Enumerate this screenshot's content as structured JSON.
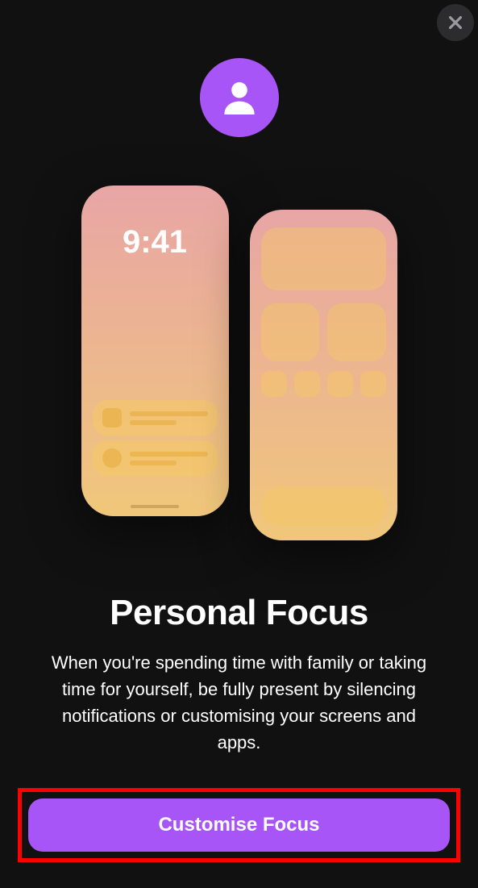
{
  "close_label": "Close",
  "icon_name": "person-icon",
  "illustration": {
    "time": "9:41"
  },
  "title": "Personal Focus",
  "description": "When you're spending time with family or taking time for yourself, be fully present by silencing notifications or customising your screens and apps.",
  "cta_label": "Customise Focus",
  "colors": {
    "accent": "#a855f7",
    "highlight_border": "#ff0000",
    "background": "#111111"
  }
}
